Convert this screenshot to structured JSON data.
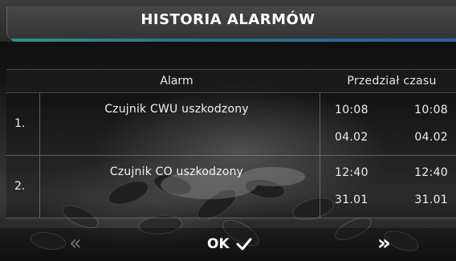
{
  "header": {
    "title": "HISTORIA ALARMÓW"
  },
  "table": {
    "columns": {
      "alarm": "Alarm",
      "time_range": "Przedział czasu"
    },
    "rows": [
      {
        "index": "1.",
        "alarm": "Czujnik CWU uszkodzony",
        "start_time": "10:08",
        "start_date": "04.02",
        "end_time": "10:08",
        "end_date": "04.02"
      },
      {
        "index": "2.",
        "alarm": "Czujnik CO uszkodzony",
        "start_time": "12:40",
        "start_date": "31.01",
        "end_time": "12:40",
        "end_date": "31.01"
      }
    ]
  },
  "footer": {
    "prev_icon": "double-chevron-left-icon",
    "ok_label": "OK",
    "ok_icon": "checkmark-icon",
    "next_icon": "double-chevron-right-icon"
  },
  "colors": {
    "accent_left": "#2e8f87",
    "accent_right": "#2f5fa6",
    "header_bg": "#3d3d3d",
    "disabled_nav": "#6f6f6f"
  }
}
